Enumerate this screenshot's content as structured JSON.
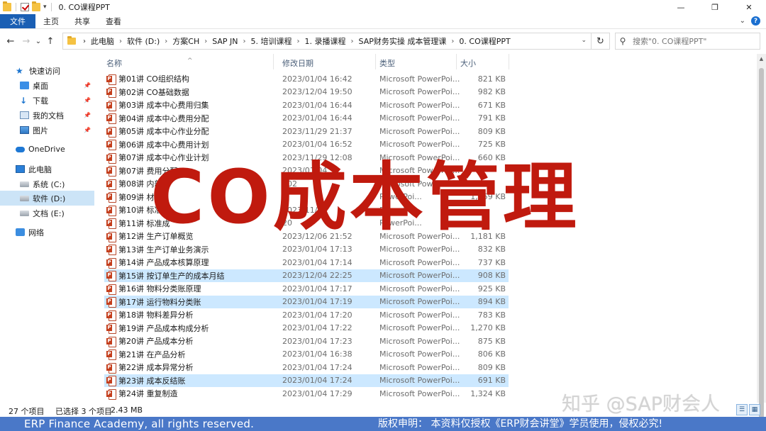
{
  "titlebar": {
    "title": "0. CO课程PPT",
    "minimize": "—",
    "maximize": "❐",
    "close": "✕"
  },
  "ribbon": {
    "tabs": [
      "文件",
      "主页",
      "共享",
      "查看"
    ],
    "expand_icon": "chevron-down-icon",
    "help_label": "?"
  },
  "nav": {
    "back": "←",
    "forward": "→",
    "recent": "⌄",
    "up": "↑"
  },
  "address": {
    "crumbs": [
      "此电脑",
      "软件 (D:)",
      "方案CH",
      "SAP JN",
      "5. 培训课程",
      "1. 录播课程",
      "SAP财务实操 成本管理课",
      "0. CO课程PPT"
    ],
    "refresh": "↻"
  },
  "search": {
    "placeholder": "搜索\"0. CO课程PPT\""
  },
  "navpane": {
    "items": [
      {
        "label": "快速访问",
        "icon": "star-icon"
      },
      {
        "label": "桌面",
        "icon": "desktop-icon",
        "pinned": true
      },
      {
        "label": "下载",
        "icon": "download-icon",
        "pinned": true
      },
      {
        "label": "我的文档",
        "icon": "document-icon",
        "pinned": true
      },
      {
        "label": "图片",
        "icon": "picture-icon",
        "pinned": true
      },
      {
        "label": "OneDrive",
        "icon": "cloud-icon"
      },
      {
        "label": "此电脑",
        "icon": "computer-icon"
      },
      {
        "label": "系统 (C:)",
        "icon": "drive-icon"
      },
      {
        "label": "软件 (D:)",
        "icon": "drive-icon",
        "selected": true
      },
      {
        "label": "文档 (E:)",
        "icon": "drive-icon"
      },
      {
        "label": "网络",
        "icon": "network-icon"
      }
    ]
  },
  "columns": {
    "name": "名称",
    "date": "修改日期",
    "type": "类型",
    "size": "大小"
  },
  "files": [
    {
      "name": "第01讲 CO组织结构",
      "date": "2023/01/04 16:42",
      "type": "Microsoft PowerPoi...",
      "size": "821 KB"
    },
    {
      "name": "第02讲 CO基础数据",
      "date": "2023/12/04 19:50",
      "type": "Microsoft PowerPoi...",
      "size": "982 KB"
    },
    {
      "name": "第03讲 成本中心费用归集",
      "date": "2023/01/04 16:44",
      "type": "Microsoft PowerPoi...",
      "size": "671 KB"
    },
    {
      "name": "第04讲 成本中心费用分配",
      "date": "2023/01/04 16:44",
      "type": "Microsoft PowerPoi...",
      "size": "791 KB"
    },
    {
      "name": "第05讲 成本中心作业分配",
      "date": "2023/11/29 21:37",
      "type": "Microsoft PowerPoi...",
      "size": "809 KB"
    },
    {
      "name": "第06讲 成本中心费用计划",
      "date": "2023/01/04 16:52",
      "type": "Microsoft PowerPoi...",
      "size": "725 KB"
    },
    {
      "name": "第07讲 成本中心作业计划",
      "date": "2023/11/29 12:08",
      "type": "Microsoft PowerPoi...",
      "size": "660 KB"
    },
    {
      "name": "第07讲 费用分配",
      "date": "2023/01/04",
      "type": "Microsoft PowerPoi...",
      "size": ""
    },
    {
      "name": "第08讲 内部",
      "date": "202",
      "type": "Microsoft PowerPoi...",
      "size": ""
    },
    {
      "name": "第09讲 材料",
      "date": "",
      "type": "PowerPoi...",
      "size": "1,259 KB"
    },
    {
      "name": "第10讲 标准",
      "date": "2023/11/",
      "type": "PowerPoi...",
      "size": ""
    },
    {
      "name": "第11讲 标准成",
      "date": "20",
      "type": "PowerPoi...",
      "size": ""
    },
    {
      "name": "第12讲 生产订单概览",
      "date": "2023/12/06 21:52",
      "type": "Microsoft PowerPoi...",
      "size": "1,181 KB"
    },
    {
      "name": "第13讲 生产订单业务演示",
      "date": "2023/01/04 17:13",
      "type": "Microsoft PowerPoi...",
      "size": "832 KB"
    },
    {
      "name": "第14讲 产品成本核算原理",
      "date": "2023/01/04 17:14",
      "type": "Microsoft PowerPoi...",
      "size": "737 KB"
    },
    {
      "name": "第15讲 按订单生产的成本月结",
      "date": "2023/12/04 22:25",
      "type": "Microsoft PowerPoi...",
      "size": "908 KB",
      "selected": true
    },
    {
      "name": "第16讲 物料分类账原理",
      "date": "2023/01/04 17:17",
      "type": "Microsoft PowerPoi...",
      "size": "925 KB"
    },
    {
      "name": "第17讲 运行物料分类账",
      "date": "2023/01/04 17:19",
      "type": "Microsoft PowerPoi...",
      "size": "894 KB",
      "selected": true
    },
    {
      "name": "第18讲 物料差异分析",
      "date": "2023/01/04 17:20",
      "type": "Microsoft PowerPoi...",
      "size": "783 KB"
    },
    {
      "name": "第19讲 产品成本构成分析",
      "date": "2023/01/04 17:22",
      "type": "Microsoft PowerPoi...",
      "size": "1,270 KB"
    },
    {
      "name": "第20讲 产品成本分析",
      "date": "2023/01/04 17:23",
      "type": "Microsoft PowerPoi...",
      "size": "875 KB"
    },
    {
      "name": "第21讲 在产品分析",
      "date": "2023/01/04 16:38",
      "type": "Microsoft PowerPoi...",
      "size": "806 KB"
    },
    {
      "name": "第22讲 成本异常分析",
      "date": "2023/01/04 17:24",
      "type": "Microsoft PowerPoi...",
      "size": "809 KB"
    },
    {
      "name": "第23讲 成本反结账",
      "date": "2023/01/04 17:24",
      "type": "Microsoft PowerPoi...",
      "size": "691 KB",
      "selected": true
    },
    {
      "name": "第24讲 重复制造",
      "date": "2023/01/04 17:29",
      "type": "Microsoft PowerPoi...",
      "size": "1,324 KB"
    }
  ],
  "status": {
    "count": "27 个项目",
    "selected": "已选择 3 个项目",
    "size": "2.43 MB"
  },
  "overlay": {
    "title": "CO成本管理",
    "watermark": "知乎 @SAP财会人"
  },
  "banner": {
    "left": "ERP Finance Academy, all rights reserved.",
    "right": "版权申明： 本资料仅授权《ERP财会讲堂》学员使用，侵权必究!"
  },
  "colors": {
    "accent": "#1a5fb4",
    "selection": "#cce8ff",
    "title_red": "#c01a0e",
    "banner": "#4a78c8"
  }
}
